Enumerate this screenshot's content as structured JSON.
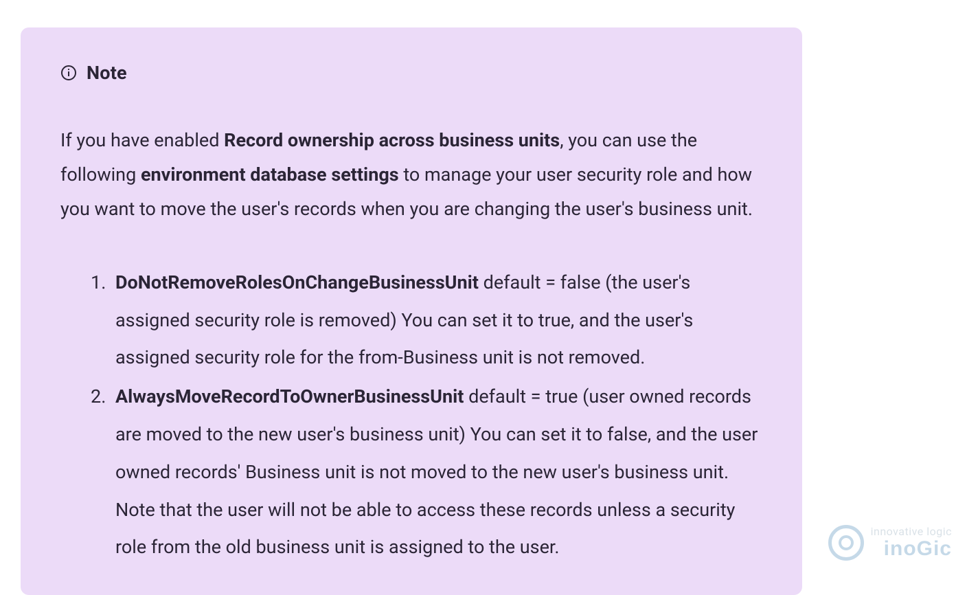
{
  "note": {
    "title": "Note",
    "para": {
      "t1": "If you have enabled ",
      "b1": "Record ownership across business units",
      "t2": ", you can use the following ",
      "b2": "environment database settings",
      "t3": " to manage your user security role and how you want to move the user's records when you are changing the user's business unit."
    },
    "items": [
      {
        "key": "DoNotRemoveRolesOnChangeBusinessUnit",
        "rest": " default = false (the user's assigned security role is removed) You can set it to true, and the user's assigned security role for the from-Business unit is not removed."
      },
      {
        "key": "AlwaysMoveRecordToOwnerBusinessUnit",
        "rest": " default = true (user owned records are moved to the new user's business unit) You can set it to false, and the user owned records' Business unit is not moved to the new user's business unit. Note that the user will not be able to access these records unless a security role from the old business unit is assigned to the user."
      }
    ]
  },
  "watermark": {
    "tag": "innovative logic",
    "brand": "inoGic"
  },
  "colors": {
    "note_bg": "#ecdbf8",
    "text": "#2b2536",
    "watermark_blue": "#1e6aa6"
  }
}
